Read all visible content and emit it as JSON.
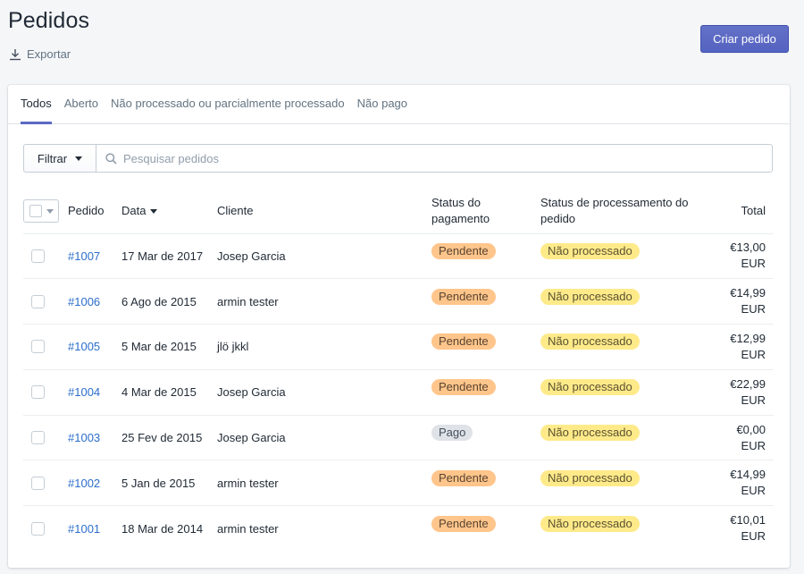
{
  "header": {
    "title": "Pedidos",
    "export_label": "Exportar",
    "create_label": "Criar pedido"
  },
  "tabs": [
    {
      "label": "Todos",
      "active": true
    },
    {
      "label": "Aberto",
      "active": false
    },
    {
      "label": "Não processado ou parcialmente processado",
      "active": false
    },
    {
      "label": "Não pago",
      "active": false
    }
  ],
  "filter": {
    "button_label": "Filtrar",
    "search_placeholder": "Pesquisar pedidos"
  },
  "table": {
    "columns": {
      "order": "Pedido",
      "date": "Data",
      "client": "Cliente",
      "payment_status": "Status do pagamento",
      "processing_status": "Status de processamento do pedido",
      "total": "Total"
    },
    "rows": [
      {
        "order": "#1007",
        "date": "17 Mar de 2017",
        "client": "Josep Garcia",
        "payment": "Pendente",
        "processing": "Não processado",
        "total_value": "€13,00",
        "total_currency": "EUR"
      },
      {
        "order": "#1006",
        "date": "6 Ago de 2015",
        "client": "armin tester",
        "payment": "Pendente",
        "processing": "Não processado",
        "total_value": "€14,99",
        "total_currency": "EUR"
      },
      {
        "order": "#1005",
        "date": "5 Mar de 2015",
        "client": "jlö jkkl",
        "payment": "Pendente",
        "processing": "Não processado",
        "total_value": "€12,99",
        "total_currency": "EUR"
      },
      {
        "order": "#1004",
        "date": "4 Mar de 2015",
        "client": "Josep Garcia",
        "payment": "Pendente",
        "processing": "Não processado",
        "total_value": "€22,99",
        "total_currency": "EUR"
      },
      {
        "order": "#1003",
        "date": "25 Fev de 2015",
        "client": "Josep Garcia",
        "payment": "Pago",
        "processing": "Não processado",
        "total_value": "€0,00",
        "total_currency": "EUR"
      },
      {
        "order": "#1002",
        "date": "5 Jan de 2015",
        "client": "armin tester",
        "payment": "Pendente",
        "processing": "Não processado",
        "total_value": "€14,99",
        "total_currency": "EUR"
      },
      {
        "order": "#1001",
        "date": "18 Mar de 2014",
        "client": "armin tester",
        "payment": "Pendente",
        "processing": "Não processado",
        "total_value": "€10,01",
        "total_currency": "EUR"
      }
    ]
  },
  "colors": {
    "accent": "#5c6ac4",
    "link": "#2c6ecb",
    "badge_pending": "#ffc58b",
    "badge_paid": "#dfe3e8",
    "badge_unfulfilled": "#ffea8a"
  }
}
